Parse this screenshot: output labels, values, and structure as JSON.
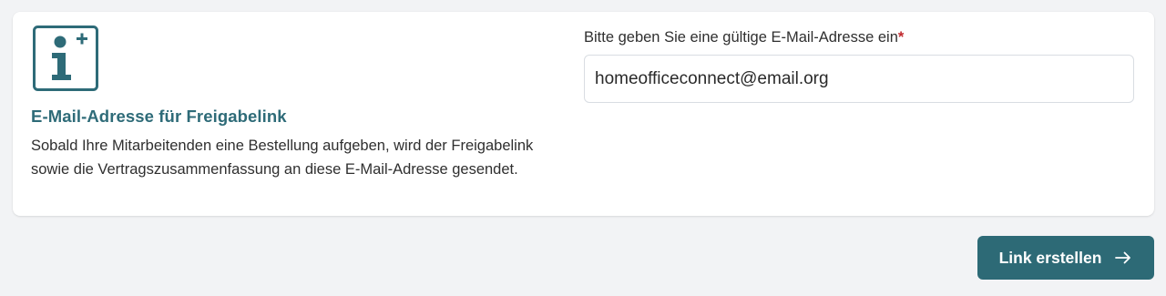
{
  "info": {
    "icon": "info-plus-icon",
    "title": "E-Mail-Adresse für Freigabelink",
    "description": "Sobald Ihre Mitarbeitenden eine Bestellung aufgeben, wird der Freigabelink sowie die Vertragszusammenfassung an diese E-Mail-Adresse gesendet."
  },
  "email_field": {
    "label": "Bitte geben Sie eine gültige E-Mail-Adresse ein",
    "required_marker": "*",
    "value": "homeofficeconnect@email.org"
  },
  "actions": {
    "create_link_label": "Link erstellen",
    "create_link_icon": "arrow-right-icon"
  },
  "colors": {
    "accent": "#2d6a76",
    "required": "#c0282d",
    "background": "#f2f3f5",
    "card": "#ffffff"
  }
}
